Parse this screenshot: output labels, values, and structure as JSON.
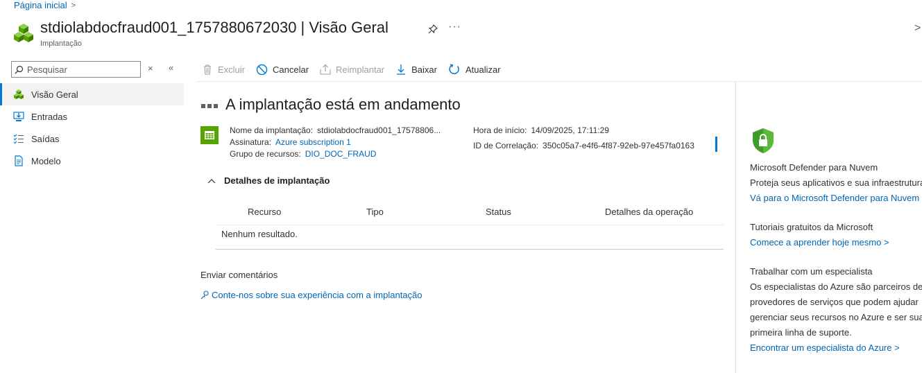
{
  "breadcrumb": {
    "home": "Página inicial",
    "separator": ">"
  },
  "header": {
    "title": "stdiolabdocfraud001_1757880672030 | Visão Geral",
    "subtitle": "Implantação",
    "more": "···",
    "close": ">"
  },
  "nav": {
    "search_placeholder": "Pesquisar",
    "clear": "×",
    "collapse": "«",
    "items": [
      {
        "label": "Visão Geral",
        "icon": "cubes-icon",
        "active": true
      },
      {
        "label": "Entradas",
        "icon": "inputs-icon"
      },
      {
        "label": "Saídas",
        "icon": "outputs-icon"
      },
      {
        "label": "Modelo",
        "icon": "template-icon"
      }
    ]
  },
  "toolbar": {
    "delete": "Excluir",
    "cancel": "Cancelar",
    "redeploy": "Reimplantar",
    "download": "Baixar",
    "refresh": "Atualizar"
  },
  "main": {
    "status_title": "A implantação está em andamento",
    "deployment_name_label": "Nome da implantação:",
    "deployment_name_value": "stdiolabdocfraud001_17578806...",
    "subscription_label": "Assinatura:",
    "subscription_value": "Azure subscription 1",
    "resource_group_label": "Grupo de recursos:",
    "resource_group_value": "DIO_DOC_FRAUD",
    "start_time_label": "Hora de início:",
    "start_time_value": "14/09/2025, 17:11:29",
    "correlation_label": "ID de Correlação:",
    "correlation_value": "350c05a7-e4f6-4f87-92eb-97e457fa0163",
    "details_toggle": "Detalhes de implantação",
    "table": {
      "columns": [
        "Recurso",
        "Tipo",
        "Status",
        "Detalhes da operação"
      ],
      "empty": "Nenhum resultado."
    },
    "feedback_title": "Enviar comentários",
    "feedback_link": "Conte-nos sobre sua experiência com a implantação"
  },
  "right_panel": {
    "defender_title": "Microsoft Defender para Nuvem",
    "defender_text": "Proteja seus aplicativos e sua infraestrutura",
    "defender_link": "Vá para o Microsoft Defender para Nuvem",
    "tutorials_title": "Tutoriais gratuitos da Microsoft",
    "tutorials_link": "Comece a aprender hoje mesmo >",
    "expert_title": "Trabalhar com um especialista",
    "expert_line1": "Os especialistas do Azure são parceiros de",
    "expert_line2": "provedores de serviços que podem ajudar",
    "expert_line3": "gerenciar seus recursos no Azure e ser sua",
    "expert_line4": "primeira linha de suporte.",
    "expert_link": "Encontrar um especialista do Azure >"
  },
  "colors": {
    "accent": "#0078d4",
    "link": "#0065b3",
    "deploy_green": "#57a300",
    "shield_green": "#3f9e2a"
  }
}
